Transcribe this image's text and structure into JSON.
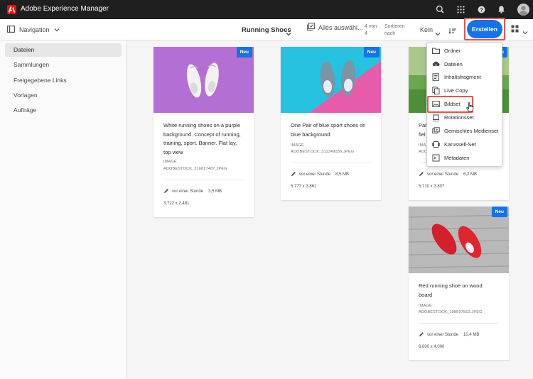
{
  "app": {
    "title": "Adobe Experience Manager"
  },
  "actionbar": {
    "nav_label": "Navigation",
    "breadcrumb": "Running Shoes",
    "select_all": "Alles auswähl...",
    "count_line1": "4 von",
    "count_line2": "4",
    "sort_line1": "Sortieren",
    "sort_line2": "nach",
    "sort_value": "Kein",
    "create_label": "Erstellen"
  },
  "sidebar": {
    "items": [
      {
        "label": "Dateien"
      },
      {
        "label": "Sammlungen"
      },
      {
        "label": "Freigegebene Links"
      },
      {
        "label": "Vorlagen"
      },
      {
        "label": "Aufträge"
      }
    ]
  },
  "cards": [
    {
      "badge": "Neu",
      "title_line1": "White running shoes on a purple",
      "title_line2": "background. Concept of running,",
      "title_line3": "training, sport. Banner. Flat lay,",
      "title_line4": "top view",
      "type": "IMAGE",
      "file": "ADOBESTOCK_316827487.JPEG",
      "modified": "vor einer Stunde",
      "size": "3,5 MB",
      "dimensions": "3.722 x 2.481"
    },
    {
      "badge": "Neu",
      "title_line1": "One Pair of blue sport shoes on",
      "title_line2": "blue background",
      "type": "IMAGE",
      "file": "ADOBESTOCK_311349030.JPEG",
      "modified": "vor einer Stunde",
      "size": "8,5 MB",
      "dimensions": "5.777 x 3.861"
    },
    {
      "badge": "Neu",
      "title_line1": "Pai",
      "title_line2": "fiel",
      "type": "IMA",
      "file": "ADO",
      "modified": "vor einer Stunde",
      "size": "6,2 MB",
      "dimensions": "5.710 x 3.807"
    },
    {
      "badge": "Neu",
      "title_line1": "Red running shoe on wood",
      "title_line2": "board",
      "type": "IMAGE",
      "file": "ADOBESTOCK_198597552.JPEG",
      "modified": "vor einer Stunde",
      "size": "10,4 MB",
      "dimensions": "6.000 x 4.000"
    }
  ],
  "create_menu": {
    "items": [
      {
        "label": "Ordner",
        "icon": "folder-icon"
      },
      {
        "label": "Dateien",
        "icon": "upload-icon"
      },
      {
        "label": "Inhaltsfragment",
        "icon": "content-fragment-icon"
      },
      {
        "label": "Live Copy",
        "icon": "live-copy-icon"
      },
      {
        "label": "Bildset",
        "icon": "image-set-icon"
      },
      {
        "label": "Rotationsset",
        "icon": "spin-set-icon"
      },
      {
        "label": "Gemischtes Medienset",
        "icon": "mixed-media-icon"
      },
      {
        "label": "Karussell-Set",
        "icon": "carousel-icon"
      },
      {
        "label": "Metadaten",
        "icon": "metadata-icon"
      }
    ]
  },
  "colors": {
    "accent": "#1473e6",
    "highlight": "#e9534f",
    "topbar": "#1f1f1f",
    "brand": "#eb1000"
  }
}
